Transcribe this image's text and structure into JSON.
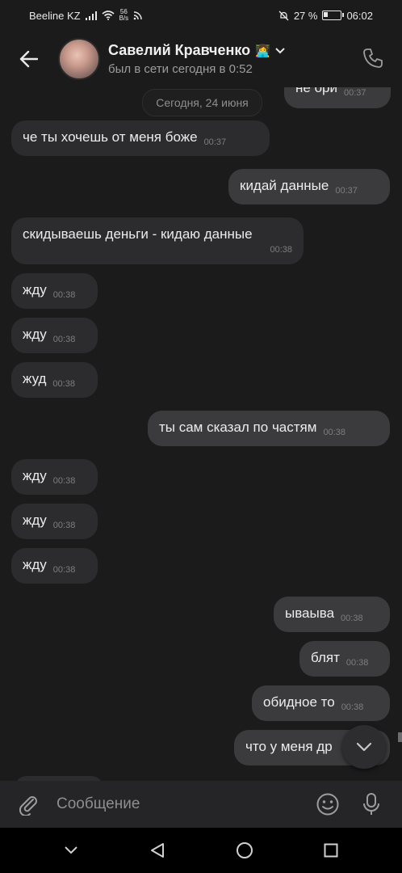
{
  "status_bar": {
    "carrier": "Beeline KZ",
    "net_speed_value": "56",
    "net_speed_unit": "B/s",
    "battery": "27 %",
    "time": "06:02"
  },
  "header": {
    "name": "Савелий Кравченко",
    "presence": "был в сети сегодня в 0:52",
    "name_emoji": "👩‍💻"
  },
  "date_divider": "Сегодня, 24 июня",
  "messages": [
    {
      "dir": "out",
      "text": "не ори",
      "time": "00:37"
    },
    {
      "dir": "in",
      "text": "че ты хочешь от меня боже",
      "time": "00:37"
    },
    {
      "dir": "out",
      "text": "кидай данные",
      "time": "00:37"
    },
    {
      "dir": "in",
      "text": "скидываешь деньги - кидаю данные",
      "time": "00:38"
    },
    {
      "dir": "in",
      "text": "жду",
      "time": "00:38"
    },
    {
      "dir": "in",
      "text": "жду",
      "time": "00:38"
    },
    {
      "dir": "in",
      "text": "жуд",
      "time": "00:38"
    },
    {
      "dir": "out",
      "text": "ты сам сказал по частям",
      "time": "00:38"
    },
    {
      "dir": "in",
      "text": "жду",
      "time": "00:38"
    },
    {
      "dir": "in",
      "text": "жду",
      "time": "00:38"
    },
    {
      "dir": "in",
      "text": "жду",
      "time": "00:38"
    },
    {
      "dir": "out",
      "text": "ываыва",
      "time": "00:38"
    },
    {
      "dir": "out",
      "text": "блят",
      "time": "00:38"
    },
    {
      "dir": "out",
      "text": "обидное то",
      "time": "00:38"
    },
    {
      "dir": "out",
      "text": "что у меня др",
      "time": ""
    }
  ],
  "composer": {
    "placeholder": "Сообщение"
  },
  "colors": {
    "background": "#1b1b1c",
    "bubble_in": "#2c2c2e",
    "bubble_out": "#3b3b3d",
    "composer": "#252527"
  }
}
